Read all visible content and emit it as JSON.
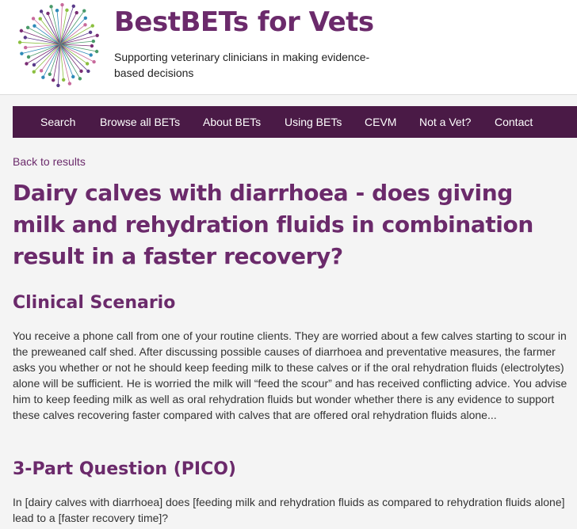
{
  "site": {
    "title": "BestBETs for Vets",
    "tagline": "Supporting veterinary clinicians in making evidence-based decisions"
  },
  "nav": {
    "items": [
      {
        "label": "Search"
      },
      {
        "label": "Browse all BETs"
      },
      {
        "label": "About BETs"
      },
      {
        "label": "Using BETs"
      },
      {
        "label": "CEVM"
      },
      {
        "label": "Not a Vet?"
      },
      {
        "label": "Contact"
      }
    ]
  },
  "back_link": "Back to results",
  "article": {
    "title": "Dairy calves with diarrhoea - does giving milk and rehydration fluids in combination result in a faster recovery?",
    "sections": [
      {
        "heading": "Clinical Scenario",
        "body": "You receive a phone call from one of your routine clients. They are worried about a few calves starting to scour in the preweaned calf shed. After discussing possible causes of diarrhoea and preventative measures, the farmer asks you whether or not he should keep feeding milk to these calves or if the oral rehydration fluids (electrolytes) alone will be sufficient. He is worried the milk will “feed the scour” and has received conflicting advice. You advise him to keep feeding milk as well as oral rehydration fluids but wonder whether there is any evidence to support these calves recovering faster compared with calves that are offered oral rehydration fluids alone..."
      },
      {
        "heading": "3-Part Question (PICO)",
        "body": "In [dairy calves with diarrhoea] does [feeding milk and rehydration fluids as compared to rehydration fluids alone] lead to a [faster recovery time]?"
      }
    ]
  },
  "colors": {
    "brand_purple": "#6b2a6b",
    "nav_background": "#4a1a46",
    "page_background": "#f4f4f4"
  }
}
